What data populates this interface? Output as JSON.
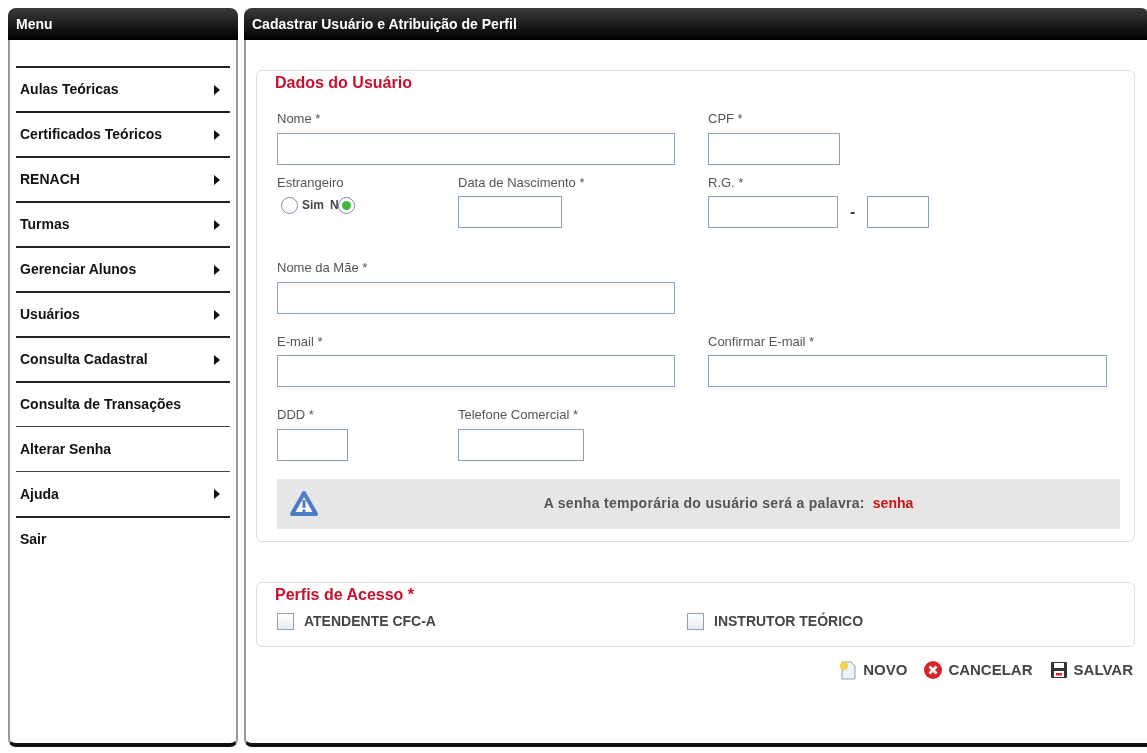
{
  "menu": {
    "title": "Menu",
    "items": [
      {
        "label": "Aulas Teóricas",
        "submenu": true
      },
      {
        "label": "Certificados Teóricos",
        "submenu": true
      },
      {
        "label": "RENACH",
        "submenu": true
      },
      {
        "label": "Turmas",
        "submenu": true
      },
      {
        "label": "Gerenciar Alunos",
        "submenu": true
      },
      {
        "label": "Usuários",
        "submenu": true
      },
      {
        "label": "Consulta Cadastral",
        "submenu": true
      },
      {
        "label": "Consulta de Transações",
        "submenu": false
      },
      {
        "label": "Alterar Senha",
        "submenu": false
      },
      {
        "label": "Ajuda",
        "submenu": true
      },
      {
        "label": "Sair",
        "submenu": false
      }
    ]
  },
  "page": {
    "title": "Cadastrar Usuário e Atribuição de Perfil"
  },
  "user_section": {
    "legend": "Dados do Usuário",
    "rows": [
      [
        {
          "kind": "text",
          "label": "Nome *"
        },
        {
          "kind": "text",
          "label": "CPF *"
        }
      ],
      [
        {
          "kind": "radio",
          "label": "Estrangeiro",
          "options": [
            {
              "label": "Sim",
              "selected": false,
              "label_before": false
            },
            {
              "label": "N",
              "selected": true,
              "label_before": true
            }
          ]
        },
        {
          "kind": "text",
          "label": "Data de Nascimento *"
        },
        {
          "kind": "rg",
          "label": "R.G. *",
          "separator": "-"
        }
      ],
      [
        {
          "kind": "text",
          "label": "Nome da Mãe *"
        }
      ],
      [
        {
          "kind": "text",
          "label": "E-mail *"
        },
        {
          "kind": "text",
          "label": "Confirmar E-mail *"
        }
      ],
      [
        {
          "kind": "text",
          "label": "DDD *"
        },
        {
          "kind": "text",
          "label": "Telefone Comercial *"
        }
      ]
    ],
    "notice": {
      "message": "A senha temporária do usuário será a palavra:",
      "keyword": "senha"
    }
  },
  "profiles": {
    "legend": "Perfis de Acesso *",
    "items": [
      {
        "label": "ATENDENTE CFC-A",
        "checked": false
      },
      {
        "label": "INSTRUTOR TEÓRICO",
        "checked": false
      }
    ]
  },
  "actions": [
    {
      "kind": "new",
      "label": "NOVO"
    },
    {
      "kind": "cancel",
      "label": "CANCELAR"
    },
    {
      "kind": "save",
      "label": "SALVAR"
    }
  ]
}
